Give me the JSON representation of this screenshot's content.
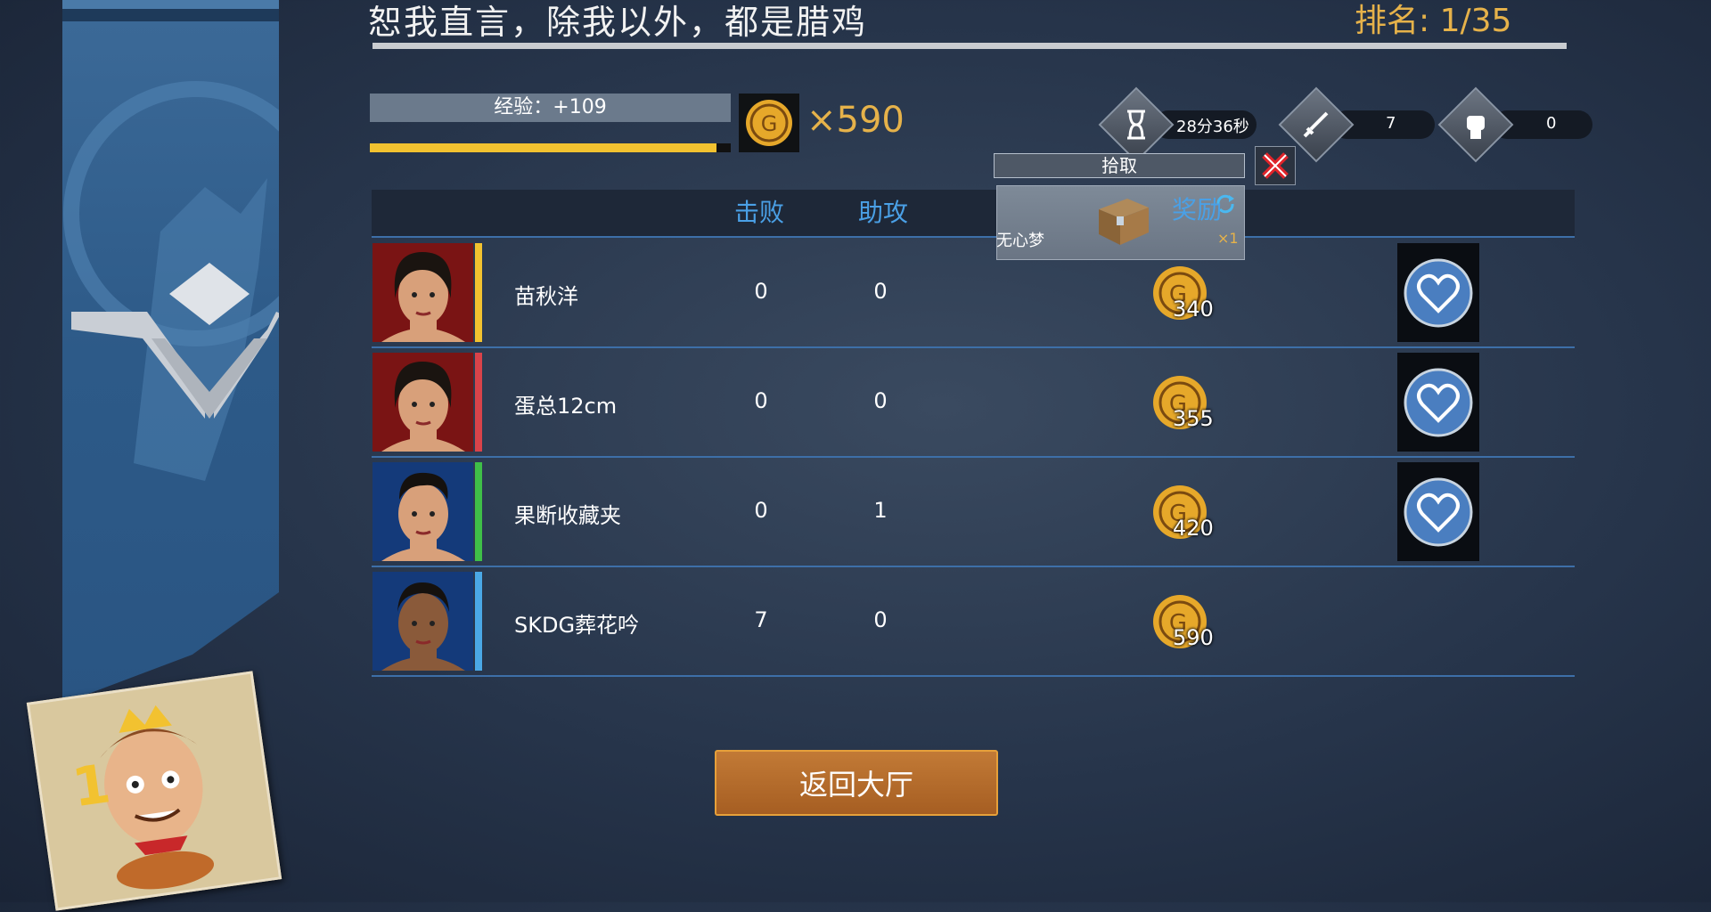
{
  "header": {
    "title": "恕我直言，除我以外，都是腊鸡",
    "rank": "排名: 1/35"
  },
  "summary": {
    "exp_label": "经验：+109",
    "exp_progress": 0.96,
    "coin_count": "×590"
  },
  "stats": {
    "time": "28分36秒",
    "kills": "7",
    "power": "0",
    "icons": [
      "hourglass-icon",
      "dagger-icon",
      "fist-icon"
    ]
  },
  "table": {
    "headers": {
      "defeat": "击败",
      "assist": "助攻"
    },
    "rows": [
      {
        "name": "苗秋洋",
        "defeat": "0",
        "assist": "0",
        "coins": "340",
        "accent": "#f2c230",
        "portrait": "female",
        "has_like": true
      },
      {
        "name": "蛋总12cm",
        "defeat": "0",
        "assist": "0",
        "coins": "355",
        "accent": "#d9434a",
        "portrait": "female",
        "has_like": true
      },
      {
        "name": "果断收藏夹",
        "defeat": "0",
        "assist": "1",
        "coins": "420",
        "accent": "#3fbf48",
        "portrait": "male",
        "has_like": true
      },
      {
        "name": "SKDG葬花吟",
        "defeat": "7",
        "assist": "0",
        "coins": "590",
        "accent": "#4aa8e6",
        "portrait": "male2",
        "has_like": false
      }
    ]
  },
  "pickup": {
    "label": "拾取",
    "reward_label": "奖励",
    "reward_name": "无心梦",
    "reward_qty": "×1"
  },
  "back_button": "返回大厅",
  "colors": {
    "accent_gold": "#e6b24a",
    "accent_blue": "#4aa0e6"
  }
}
